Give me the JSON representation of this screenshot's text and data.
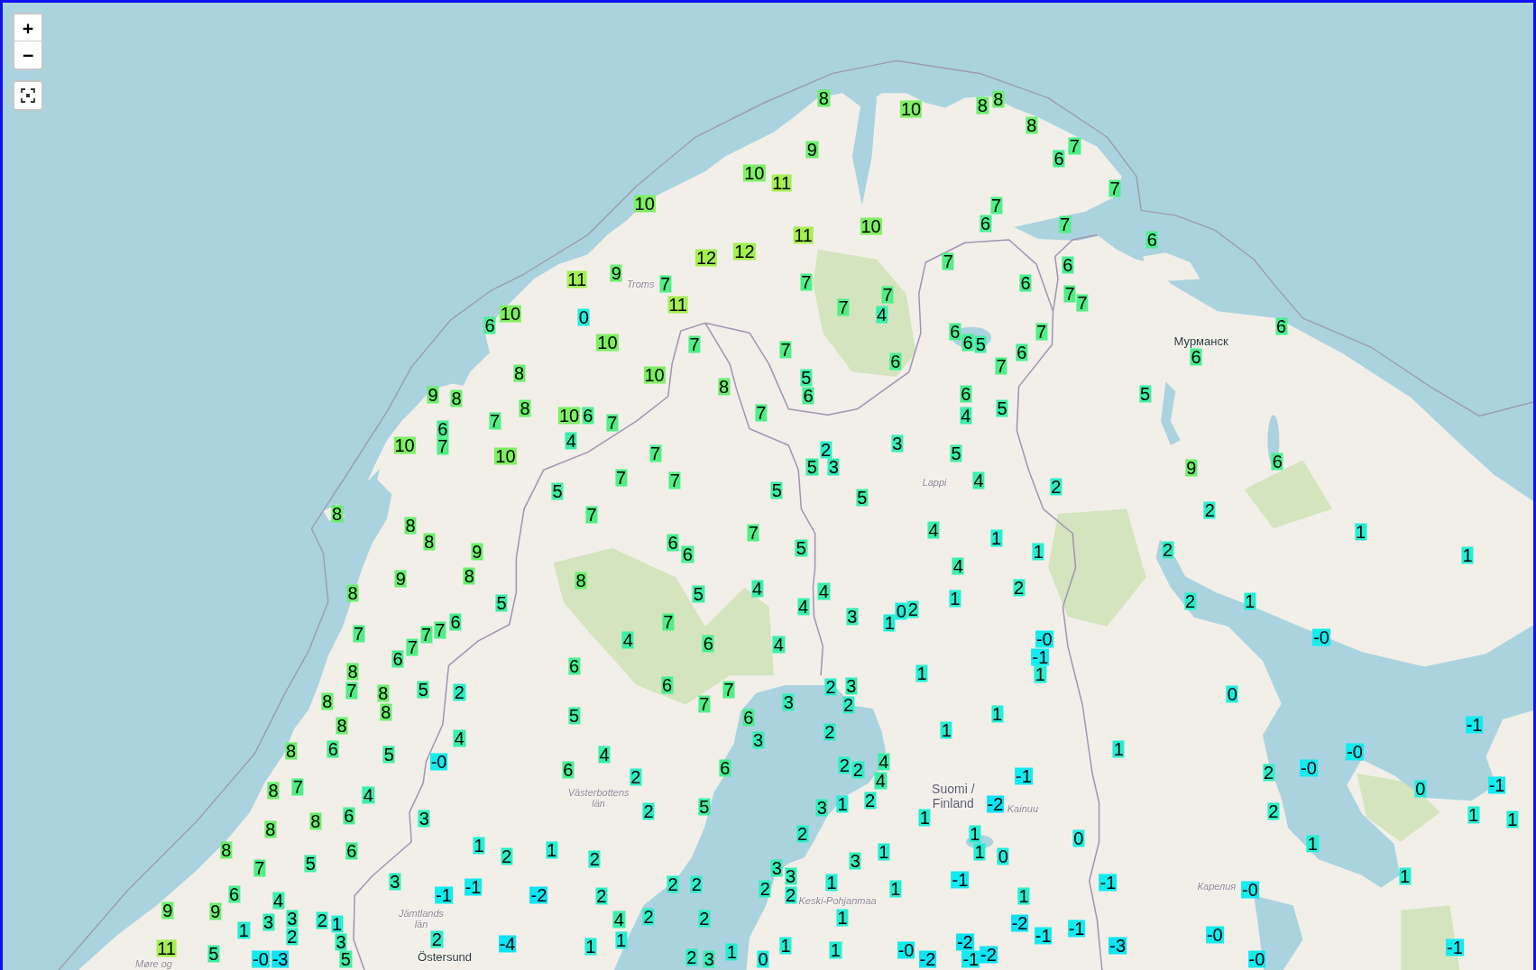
{
  "map": {
    "controls": {
      "zoom_in": "+",
      "zoom_out": "−"
    },
    "place_labels": [
      {
        "text": "Troms",
        "kind": "region"
      },
      {
        "text": "Мурманск",
        "kind": "city"
      },
      {
        "text": "Lappi",
        "kind": "region"
      },
      {
        "text": "Västerbottens län",
        "kind": "region"
      },
      {
        "text": "Suomi / Finland",
        "kind": "country"
      },
      {
        "text": "Kainuu",
        "kind": "region"
      },
      {
        "text": "Карелия",
        "kind": "region"
      },
      {
        "text": "Keski-Pohjanmaa",
        "kind": "region"
      },
      {
        "text": "Jämtlands län",
        "kind": "region"
      },
      {
        "text": "Møre og",
        "kind": "region"
      },
      {
        "text": "Östersund",
        "kind": "city"
      }
    ],
    "markers": [
      {
        "value": "8",
        "color": "#68f06a"
      },
      {
        "value": "8",
        "color": "#68f06a"
      },
      {
        "value": "8",
        "color": "#68f06a"
      },
      {
        "value": "10",
        "color": "#7df061"
      },
      {
        "value": "8",
        "color": "#68f06a"
      },
      {
        "value": "9",
        "color": "#68f06a"
      },
      {
        "value": "7",
        "color": "#4ef085"
      },
      {
        "value": "6",
        "color": "#45f090"
      },
      {
        "value": "10",
        "color": "#7df061"
      },
      {
        "value": "11",
        "color": "#a3f04f"
      },
      {
        "value": "7",
        "color": "#4ef085"
      },
      {
        "value": "10",
        "color": "#7df061"
      },
      {
        "value": "7",
        "color": "#4ef085"
      },
      {
        "value": "10",
        "color": "#7df061"
      },
      {
        "value": "6",
        "color": "#45f090"
      },
      {
        "value": "7",
        "color": "#4ef085"
      },
      {
        "value": "11",
        "color": "#a3f04f"
      },
      {
        "value": "6",
        "color": "#45f090"
      },
      {
        "value": "12",
        "color": "#a3f04f"
      },
      {
        "value": "12",
        "color": "#a3f04f"
      },
      {
        "value": "7",
        "color": "#4ef085"
      },
      {
        "value": "6",
        "color": "#45f090"
      },
      {
        "value": "11",
        "color": "#a3f04f"
      },
      {
        "value": "9",
        "color": "#68f06a"
      },
      {
        "value": "7",
        "color": "#4ef085"
      },
      {
        "value": "7",
        "color": "#4ef085"
      },
      {
        "value": "6",
        "color": "#45f090"
      },
      {
        "value": "7",
        "color": "#4ef085"
      },
      {
        "value": "7",
        "color": "#4ef085"
      },
      {
        "value": "11",
        "color": "#a3f04f"
      },
      {
        "value": "7",
        "color": "#4ef085"
      },
      {
        "value": "7",
        "color": "#4ef085"
      },
      {
        "value": "10",
        "color": "#7df061"
      },
      {
        "value": "0",
        "color": "#1cf0e0"
      },
      {
        "value": "4",
        "color": "#38f0aa"
      },
      {
        "value": "6",
        "color": "#45f090"
      },
      {
        "value": "6",
        "color": "#45f090"
      },
      {
        "value": "7",
        "color": "#4ef085"
      },
      {
        "value": "6",
        "color": "#45f090"
      },
      {
        "value": "10",
        "color": "#7df061"
      },
      {
        "value": "7",
        "color": "#4ef085"
      },
      {
        "value": "7",
        "color": "#4ef085"
      },
      {
        "value": "6",
        "color": "#45f090"
      },
      {
        "value": "5",
        "color": "#3cf0a2"
      },
      {
        "value": "6",
        "color": "#45f090"
      },
      {
        "value": "7",
        "color": "#4ef085"
      },
      {
        "value": "6",
        "color": "#45f090"
      },
      {
        "value": "6",
        "color": "#45f090"
      },
      {
        "value": "8",
        "color": "#68f06a"
      },
      {
        "value": "10",
        "color": "#7df061"
      },
      {
        "value": "5",
        "color": "#3cf0a2"
      },
      {
        "value": "9",
        "color": "#68f06a"
      },
      {
        "value": "8",
        "color": "#68f06a"
      },
      {
        "value": "8",
        "color": "#68f06a"
      },
      {
        "value": "6",
        "color": "#45f090"
      },
      {
        "value": "6",
        "color": "#45f090"
      },
      {
        "value": "5",
        "color": "#3cf0a2"
      },
      {
        "value": "8",
        "color": "#68f06a"
      },
      {
        "value": "5",
        "color": "#3cf0a2"
      },
      {
        "value": "7",
        "color": "#4ef085"
      },
      {
        "value": "10",
        "color": "#7df061"
      },
      {
        "value": "6",
        "color": "#45f090"
      },
      {
        "value": "7",
        "color": "#4ef085"
      },
      {
        "value": "4",
        "color": "#38f0aa"
      },
      {
        "value": "6",
        "color": "#45f090"
      },
      {
        "value": "7",
        "color": "#4ef085"
      },
      {
        "value": "10",
        "color": "#7df061"
      },
      {
        "value": "7",
        "color": "#4ef085"
      },
      {
        "value": "4",
        "color": "#38f0aa"
      },
      {
        "value": "3",
        "color": "#32f0b8"
      },
      {
        "value": "10",
        "color": "#7df061"
      },
      {
        "value": "7",
        "color": "#4ef085"
      },
      {
        "value": "2",
        "color": "#2af0c8"
      },
      {
        "value": "5",
        "color": "#3cf0a2"
      },
      {
        "value": "5",
        "color": "#3cf0a2"
      },
      {
        "value": "3",
        "color": "#32f0b8"
      },
      {
        "value": "9",
        "color": "#68f06a"
      },
      {
        "value": "6",
        "color": "#45f090"
      },
      {
        "value": "7",
        "color": "#4ef085"
      },
      {
        "value": "7",
        "color": "#4ef085"
      },
      {
        "value": "4",
        "color": "#38f0aa"
      },
      {
        "value": "5",
        "color": "#3cf0a2"
      },
      {
        "value": "5",
        "color": "#3cf0a2"
      },
      {
        "value": "2",
        "color": "#2af0c8"
      },
      {
        "value": "5",
        "color": "#3cf0a2"
      },
      {
        "value": "8",
        "color": "#68f06a"
      },
      {
        "value": "7",
        "color": "#4ef085"
      },
      {
        "value": "2",
        "color": "#2af0c8"
      },
      {
        "value": "8",
        "color": "#68f06a"
      },
      {
        "value": "7",
        "color": "#4ef085"
      },
      {
        "value": "4",
        "color": "#38f0aa"
      },
      {
        "value": "1",
        "color": "#22f0d4"
      },
      {
        "value": "8",
        "color": "#68f06a"
      },
      {
        "value": "6",
        "color": "#45f090"
      },
      {
        "value": "1",
        "color": "#22f0d4"
      },
      {
        "value": "9",
        "color": "#68f06a"
      },
      {
        "value": "6",
        "color": "#45f090"
      },
      {
        "value": "5",
        "color": "#3cf0a2"
      },
      {
        "value": "1",
        "color": "#22f0d4"
      },
      {
        "value": "2",
        "color": "#2af0c8"
      },
      {
        "value": "1",
        "color": "#22f0d4"
      },
      {
        "value": "4",
        "color": "#38f0aa"
      },
      {
        "value": "9",
        "color": "#68f06a"
      },
      {
        "value": "8",
        "color": "#68f06a"
      },
      {
        "value": "8",
        "color": "#68f06a"
      },
      {
        "value": "8",
        "color": "#68f06a"
      },
      {
        "value": "5",
        "color": "#3cf0a2"
      },
      {
        "value": "4",
        "color": "#38f0aa"
      },
      {
        "value": "4",
        "color": "#38f0aa"
      },
      {
        "value": "2",
        "color": "#2af0c8"
      },
      {
        "value": "5",
        "color": "#3cf0a2"
      },
      {
        "value": "4",
        "color": "#38f0aa"
      },
      {
        "value": "0",
        "color": "#1cf0e0"
      },
      {
        "value": "2",
        "color": "#2af0c8"
      },
      {
        "value": "1",
        "color": "#22f0d4"
      },
      {
        "value": "2",
        "color": "#2af0c8"
      },
      {
        "value": "1",
        "color": "#22f0d4"
      },
      {
        "value": "6",
        "color": "#45f090"
      },
      {
        "value": "7",
        "color": "#4ef085"
      },
      {
        "value": "3",
        "color": "#32f0b8"
      },
      {
        "value": "1",
        "color": "#22f0d4"
      },
      {
        "value": "7",
        "color": "#4ef085"
      },
      {
        "value": "7",
        "color": "#4ef085"
      },
      {
        "value": "7",
        "color": "#4ef085"
      },
      {
        "value": "-0",
        "color": "#10ecf0"
      },
      {
        "value": "7",
        "color": "#4ef085"
      },
      {
        "value": "4",
        "color": "#38f0aa"
      },
      {
        "value": "6",
        "color": "#45f090"
      },
      {
        "value": "4",
        "color": "#38f0aa"
      },
      {
        "value": "-0",
        "color": "#10ecf0"
      },
      {
        "value": "6",
        "color": "#45f090"
      },
      {
        "value": "-1",
        "color": "#10ecf0"
      },
      {
        "value": "8",
        "color": "#68f06a"
      },
      {
        "value": "6",
        "color": "#45f090"
      },
      {
        "value": "1",
        "color": "#22f0d4"
      },
      {
        "value": "1",
        "color": "#22f0d4"
      },
      {
        "value": "7",
        "color": "#4ef085"
      },
      {
        "value": "8",
        "color": "#68f06a"
      },
      {
        "value": "5",
        "color": "#3cf0a2"
      },
      {
        "value": "2",
        "color": "#2af0c8"
      },
      {
        "value": "6",
        "color": "#45f090"
      },
      {
        "value": "7",
        "color": "#4ef085"
      },
      {
        "value": "2",
        "color": "#2af0c8"
      },
      {
        "value": "3",
        "color": "#32f0b8"
      },
      {
        "value": "8",
        "color": "#68f06a"
      },
      {
        "value": "3",
        "color": "#32f0b8"
      },
      {
        "value": "0",
        "color": "#1cf0e0"
      },
      {
        "value": "8",
        "color": "#68f06a"
      },
      {
        "value": "7",
        "color": "#4ef085"
      },
      {
        "value": "2",
        "color": "#2af0c8"
      },
      {
        "value": "5",
        "color": "#3cf0a2"
      },
      {
        "value": "6",
        "color": "#45f090"
      },
      {
        "value": "1",
        "color": "#22f0d4"
      },
      {
        "value": "8",
        "color": "#68f06a"
      },
      {
        "value": "2",
        "color": "#2af0c8"
      },
      {
        "value": "1",
        "color": "#22f0d4"
      },
      {
        "value": "-1",
        "color": "#10ecf0"
      },
      {
        "value": "4",
        "color": "#38f0aa"
      },
      {
        "value": "3",
        "color": "#32f0b8"
      },
      {
        "value": "8",
        "color": "#68f06a"
      },
      {
        "value": "6",
        "color": "#45f090"
      },
      {
        "value": "5",
        "color": "#3cf0a2"
      },
      {
        "value": "4",
        "color": "#38f0aa"
      },
      {
        "value": "1",
        "color": "#22f0d4"
      },
      {
        "value": "-0",
        "color": "#10ecf0"
      },
      {
        "value": "-0",
        "color": "#10ecf0"
      },
      {
        "value": "6",
        "color": "#45f090"
      },
      {
        "value": "6",
        "color": "#45f090"
      },
      {
        "value": "2",
        "color": "#2af0c8"
      },
      {
        "value": "2",
        "color": "#2af0c8"
      },
      {
        "value": "4",
        "color": "#38f0aa"
      },
      {
        "value": "-0",
        "color": "#10ecf0"
      },
      {
        "value": "2",
        "color": "#2af0c8"
      },
      {
        "value": "4",
        "color": "#38f0aa"
      },
      {
        "value": "-1",
        "color": "#10ecf0"
      },
      {
        "value": "2",
        "color": "#2af0c8"
      },
      {
        "value": "8",
        "color": "#68f06a"
      },
      {
        "value": "7",
        "color": "#4ef085"
      },
      {
        "value": "0",
        "color": "#1cf0e0"
      },
      {
        "value": "-1",
        "color": "#10ecf0"
      },
      {
        "value": "4",
        "color": "#38f0aa"
      },
      {
        "value": "2",
        "color": "#2af0c8"
      },
      {
        "value": "2",
        "color": "#2af0c8"
      },
      {
        "value": "5",
        "color": "#3cf0a2"
      },
      {
        "value": "3",
        "color": "#32f0b8"
      },
      {
        "value": "1",
        "color": "#22f0d4"
      },
      {
        "value": "-2",
        "color": "#0ae4f4"
      },
      {
        "value": "2",
        "color": "#2af0c8"
      },
      {
        "value": "8",
        "color": "#68f06a"
      },
      {
        "value": "6",
        "color": "#45f090"
      },
      {
        "value": "3",
        "color": "#32f0b8"
      },
      {
        "value": "1",
        "color": "#22f0d4"
      },
      {
        "value": "1",
        "color": "#22f0d4"
      },
      {
        "value": "1",
        "color": "#22f0d4"
      },
      {
        "value": "8",
        "color": "#68f06a"
      },
      {
        "value": "2",
        "color": "#2af0c8"
      },
      {
        "value": "1",
        "color": "#22f0d4"
      },
      {
        "value": "0",
        "color": "#1cf0e0"
      },
      {
        "value": "8",
        "color": "#68f06a"
      },
      {
        "value": "6",
        "color": "#45f090"
      },
      {
        "value": "1",
        "color": "#22f0d4"
      },
      {
        "value": "2",
        "color": "#2af0c8"
      },
      {
        "value": "1",
        "color": "#22f0d4"
      },
      {
        "value": "1",
        "color": "#22f0d4"
      },
      {
        "value": "1",
        "color": "#22f0d4"
      },
      {
        "value": "0",
        "color": "#1cf0e0"
      },
      {
        "value": "1",
        "color": "#22f0d4"
      },
      {
        "value": "7",
        "color": "#4ef085"
      },
      {
        "value": "5",
        "color": "#3cf0a2"
      },
      {
        "value": "2",
        "color": "#2af0c8"
      },
      {
        "value": "3",
        "color": "#32f0b8"
      },
      {
        "value": "3",
        "color": "#32f0b8"
      },
      {
        "value": "3",
        "color": "#32f0b8"
      },
      {
        "value": "3",
        "color": "#32f0b8"
      },
      {
        "value": "-1",
        "color": "#10ecf0"
      },
      {
        "value": "2",
        "color": "#2af0c8"
      },
      {
        "value": "2",
        "color": "#2af0c8"
      },
      {
        "value": "1",
        "color": "#22f0d4"
      },
      {
        "value": "-1",
        "color": "#10ecf0"
      },
      {
        "value": "-1",
        "color": "#10ecf0"
      },
      {
        "value": "1",
        "color": "#22f0d4"
      },
      {
        "value": "6",
        "color": "#45f090"
      },
      {
        "value": "-1",
        "color": "#10ecf0"
      },
      {
        "value": "-2",
        "color": "#0ae4f4"
      },
      {
        "value": "2",
        "color": "#2af0c8"
      },
      {
        "value": "2",
        "color": "#2af0c8"
      },
      {
        "value": "2",
        "color": "#2af0c8"
      },
      {
        "value": "1",
        "color": "#22f0d4"
      },
      {
        "value": "1",
        "color": "#22f0d4"
      },
      {
        "value": "-0",
        "color": "#10ecf0"
      },
      {
        "value": "4",
        "color": "#38f0aa"
      },
      {
        "value": "9",
        "color": "#68f06a"
      },
      {
        "value": "9",
        "color": "#68f06a"
      },
      {
        "value": "1",
        "color": "#22f0d4"
      },
      {
        "value": "3",
        "color": "#32f0b8"
      },
      {
        "value": "3",
        "color": "#32f0b8"
      },
      {
        "value": "2",
        "color": "#2af0c8"
      },
      {
        "value": "1",
        "color": "#22f0d4"
      },
      {
        "value": "4",
        "color": "#38f0aa"
      },
      {
        "value": "2",
        "color": "#2af0c8"
      },
      {
        "value": "2",
        "color": "#2af0c8"
      },
      {
        "value": "1",
        "color": "#22f0d4"
      },
      {
        "value": "-2",
        "color": "#0ae4f4"
      },
      {
        "value": "2",
        "color": "#2af0c8"
      },
      {
        "value": "3",
        "color": "#32f0b8"
      },
      {
        "value": "2",
        "color": "#2af0c8"
      },
      {
        "value": "-4",
        "color": "#0ae4f4"
      },
      {
        "value": "1",
        "color": "#22f0d4"
      },
      {
        "value": "-2",
        "color": "#0ae4f4"
      },
      {
        "value": "-1",
        "color": "#10ecf0"
      },
      {
        "value": "-1",
        "color": "#10ecf0"
      },
      {
        "value": "-0",
        "color": "#10ecf0"
      },
      {
        "value": "11",
        "color": "#a3f04f"
      },
      {
        "value": "5",
        "color": "#3cf0a2"
      },
      {
        "value": "1",
        "color": "#22f0d4"
      },
      {
        "value": "1",
        "color": "#22f0d4"
      },
      {
        "value": "1",
        "color": "#22f0d4"
      },
      {
        "value": "1",
        "color": "#22f0d4"
      },
      {
        "value": "-0",
        "color": "#10ecf0"
      },
      {
        "value": "-2",
        "color": "#0ae4f4"
      },
      {
        "value": "-3",
        "color": "#0ae4f4"
      },
      {
        "value": "-1",
        "color": "#10ecf0"
      },
      {
        "value": "-0",
        "color": "#10ecf0"
      },
      {
        "value": "-3",
        "color": "#0ae4f4"
      },
      {
        "value": "5",
        "color": "#3cf0a2"
      },
      {
        "value": "2",
        "color": "#2af0c8"
      },
      {
        "value": "3",
        "color": "#32f0b8"
      },
      {
        "value": "0",
        "color": "#1cf0e0"
      },
      {
        "value": "-2",
        "color": "#0ae4f4"
      },
      {
        "value": "-1",
        "color": "#10ecf0"
      },
      {
        "value": "-0",
        "color": "#10ecf0"
      }
    ]
  }
}
